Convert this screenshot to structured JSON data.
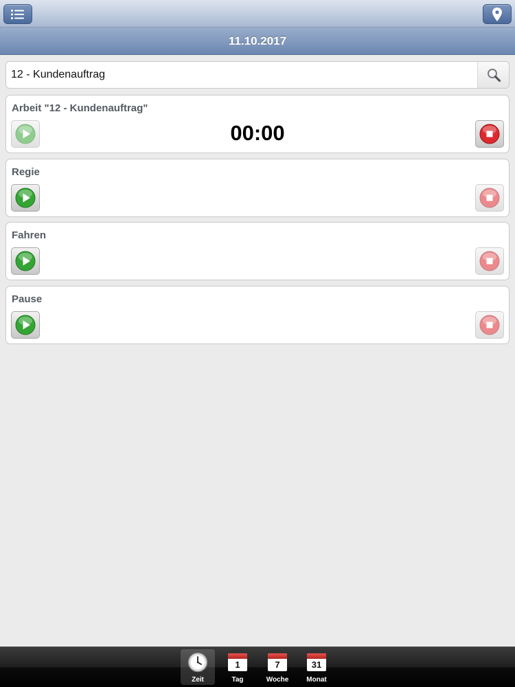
{
  "header": {
    "menu_icon": "list-icon",
    "location_icon": "map-pin-icon",
    "date": "11.10.2017"
  },
  "search": {
    "value": "12 - Kundenauftrag",
    "icon": "search-icon"
  },
  "activities": [
    {
      "title": "Arbeit \"12 - Kundenauftrag\"",
      "timer": "00:00",
      "running": true
    },
    {
      "title": "Regie",
      "running": false
    },
    {
      "title": "Fahren",
      "running": false
    },
    {
      "title": "Pause",
      "running": false
    }
  ],
  "tabs": [
    {
      "label": "Zeit",
      "icon": "clock-icon",
      "active": true
    },
    {
      "label": "Tag",
      "icon": "calendar-icon",
      "number": "1"
    },
    {
      "label": "Woche",
      "icon": "calendar-icon",
      "number": "7"
    },
    {
      "label": "Monat",
      "icon": "calendar-icon",
      "number": "31"
    }
  ],
  "colors": {
    "play": "#2f9e2f",
    "stop": "#d8262b",
    "header_blue": "#6b86b0"
  }
}
